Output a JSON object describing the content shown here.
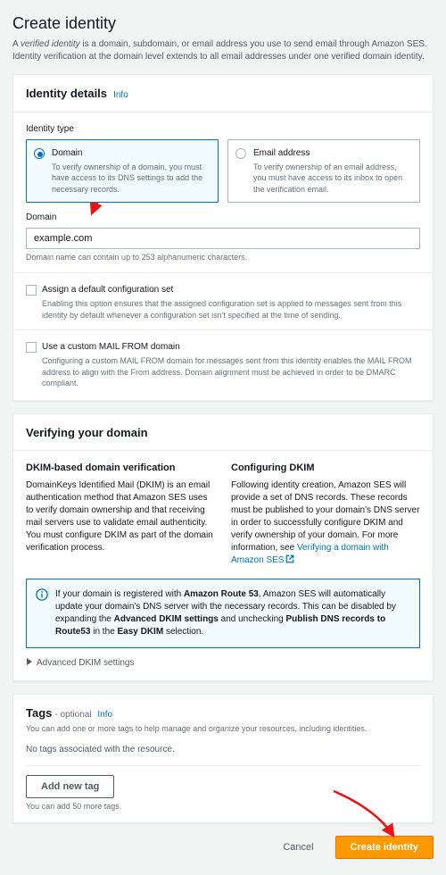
{
  "page": {
    "title": "Create identity",
    "subtitle_prefix": "A ",
    "subtitle_italic": "verified identity",
    "subtitle_rest": " is a domain, subdomain, or email address you use to send email through Amazon SES. Identity verification at the domain level extends to all email addresses under one verified domain identity."
  },
  "details": {
    "header": "Identity details",
    "info": "Info",
    "type_label": "Identity type",
    "domain": {
      "title": "Domain",
      "desc": "To verify ownership of a domain, you must have access to its DNS settings to add the necessary records."
    },
    "email": {
      "title": "Email address",
      "desc": "To verify ownership of an email address, you must have access to its inbox to open the verification email."
    },
    "domain_label": "Domain",
    "domain_value": "example.com",
    "domain_helper": "Domain name can contain up to 253 alphanumeric characters.",
    "assign_cfg": {
      "label": "Assign a default configuration set",
      "desc": "Enabling this option ensures that the assigned configuration set is applied to messages sent from this identity by default whenever a configuration set isn't specified at the time of sending."
    },
    "mail_from": {
      "label": "Use a custom MAIL FROM domain",
      "desc": "Configuring a custom MAIL FROM domain for messages sent from this identity enables the MAIL FROM address to align with the From address. Domain alignment must be achieved in order to be DMARC compliant."
    }
  },
  "verify": {
    "header": "Verifying your domain",
    "dkim_title": "DKIM-based domain verification",
    "dkim_text": "DomainKeys Identified Mail (DKIM) is an email authentication method that Amazon SES uses to verify domain ownership and that receiving mail servers use to validate email authenticity. You must configure DKIM as part of the domain verification process.",
    "cfg_title": "Configuring DKIM",
    "cfg_text": "Following identity creation, Amazon SES will provide a set of DNS records. These records must be published to your domain's DNS server in order to successfully configure DKIM and verify ownership of your domain. For more information, see ",
    "cfg_link": "Verifying a domain with Amazon SES",
    "info_box_pre": "If your domain is registered with ",
    "info_box_b1": "Amazon Route 53",
    "info_box_mid": ", Amazon SES will automatically update your domain's DNS server with the necessary records. This can be disabled by expanding the ",
    "info_box_b2": "Advanced DKIM settings",
    "info_box_mid2": " and unchecking ",
    "info_box_b3": "Publish DNS records to Route53",
    "info_box_mid3": " in the ",
    "info_box_b4": "Easy DKIM",
    "info_box_end": " selection.",
    "advanced": "Advanced DKIM settings"
  },
  "tags": {
    "header": "Tags",
    "optional": "- optional",
    "info": "Info",
    "desc": "You can add one or more tags to help manage and organize your resources, including identities.",
    "none": "No tags associated with the resource.",
    "add_btn": "Add new tag",
    "limit": "You can add 50 more tags."
  },
  "footer": {
    "cancel": "Cancel",
    "create": "Create identity"
  }
}
